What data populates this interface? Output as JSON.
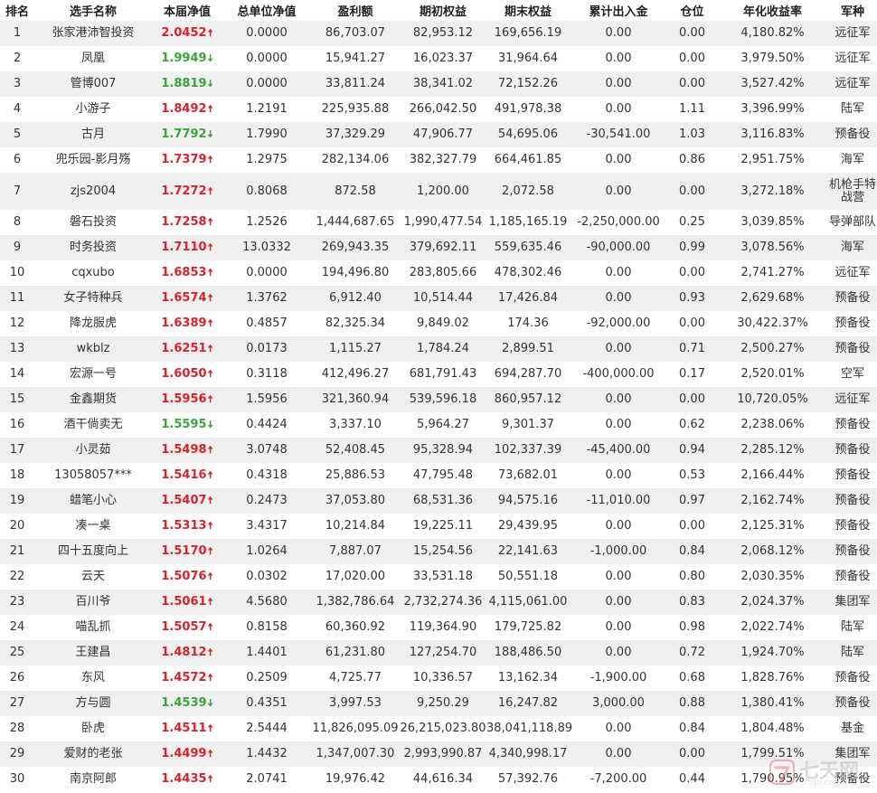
{
  "headers": [
    "排名",
    "选手名称",
    "本届净值",
    "总单位净值",
    "盈利额",
    "期初权益",
    "期末权益",
    "累计出入金",
    "仓位",
    "年化收益率",
    "军种"
  ],
  "rows": [
    {
      "rank": "1",
      "name": "张家港沛智投资",
      "nav": "2.0452",
      "dir": "up",
      "total_nav": "0.0000",
      "profit": "86,703.07",
      "begin": "82,953.12",
      "end": "169,656.19",
      "flow": "0.00",
      "position": "0.00",
      "annual": "4,180.82%",
      "military": "远征军"
    },
    {
      "rank": "2",
      "name": "凤凰",
      "nav": "1.9949",
      "dir": "down",
      "total_nav": "0.0000",
      "profit": "15,941.27",
      "begin": "16,023.37",
      "end": "31,964.64",
      "flow": "0.00",
      "position": "0.00",
      "annual": "3,979.50%",
      "military": "远征军"
    },
    {
      "rank": "3",
      "name": "管博007",
      "nav": "1.8819",
      "dir": "down",
      "total_nav": "0.0000",
      "profit": "33,811.24",
      "begin": "38,341.02",
      "end": "72,152.26",
      "flow": "0.00",
      "position": "0.00",
      "annual": "3,527.42%",
      "military": "远征军"
    },
    {
      "rank": "4",
      "name": "小游子",
      "nav": "1.8492",
      "dir": "up",
      "total_nav": "1.2191",
      "profit": "225,935.88",
      "begin": "266,042.50",
      "end": "491,978.38",
      "flow": "0.00",
      "position": "1.11",
      "annual": "3,396.99%",
      "military": "陆军"
    },
    {
      "rank": "5",
      "name": "古月",
      "nav": "1.7792",
      "dir": "down",
      "total_nav": "1.7990",
      "profit": "37,329.29",
      "begin": "47,906.77",
      "end": "54,695.06",
      "flow": "-30,541.00",
      "position": "1.03",
      "annual": "3,116.83%",
      "military": "预备役"
    },
    {
      "rank": "6",
      "name": "兜乐园-影月殇",
      "nav": "1.7379",
      "dir": "up",
      "total_nav": "1.2975",
      "profit": "282,134.06",
      "begin": "382,327.79",
      "end": "664,461.85",
      "flow": "0.00",
      "position": "0.86",
      "annual": "2,951.75%",
      "military": "海军"
    },
    {
      "rank": "7",
      "name": "zjs2004",
      "nav": "1.7272",
      "dir": "up",
      "total_nav": "0.8068",
      "profit": "872.58",
      "begin": "1,200.00",
      "end": "2,072.58",
      "flow": "0.00",
      "position": "0.00",
      "annual": "3,272.18%",
      "military": "机枪手特战营"
    },
    {
      "rank": "8",
      "name": "磐石投资",
      "nav": "1.7258",
      "dir": "up",
      "total_nav": "1.2526",
      "profit": "1,444,687.65",
      "begin": "1,990,477.54",
      "end": "1,185,165.19",
      "flow": "-2,250,000.00",
      "position": "0.25",
      "annual": "3,039.85%",
      "military": "导弹部队"
    },
    {
      "rank": "9",
      "name": "时务投资",
      "nav": "1.7110",
      "dir": "up",
      "total_nav": "13.0332",
      "profit": "269,943.35",
      "begin": "379,692.11",
      "end": "559,635.46",
      "flow": "-90,000.00",
      "position": "0.99",
      "annual": "3,078.56%",
      "military": "海军"
    },
    {
      "rank": "10",
      "name": "cqxubo",
      "nav": "1.6853",
      "dir": "up",
      "total_nav": "0.0000",
      "profit": "194,496.80",
      "begin": "283,805.66",
      "end": "478,302.46",
      "flow": "0.00",
      "position": "0.00",
      "annual": "2,741.27%",
      "military": "远征军"
    },
    {
      "rank": "11",
      "name": "女子特种兵",
      "nav": "1.6574",
      "dir": "up",
      "total_nav": "1.3762",
      "profit": "6,912.40",
      "begin": "10,514.44",
      "end": "17,426.84",
      "flow": "0.00",
      "position": "0.93",
      "annual": "2,629.68%",
      "military": "预备役"
    },
    {
      "rank": "12",
      "name": "降龙服虎",
      "nav": "1.6389",
      "dir": "up",
      "total_nav": "0.4857",
      "profit": "82,325.34",
      "begin": "9,849.02",
      "end": "174.36",
      "flow": "-92,000.00",
      "position": "0.00",
      "annual": "30,422.37%",
      "military": "预备役"
    },
    {
      "rank": "13",
      "name": "wkblz",
      "nav": "1.6251",
      "dir": "up",
      "total_nav": "0.0173",
      "profit": "1,115.27",
      "begin": "1,784.24",
      "end": "2,899.51",
      "flow": "0.00",
      "position": "0.71",
      "annual": "2,500.27%",
      "military": "预备役"
    },
    {
      "rank": "14",
      "name": "宏源一号",
      "nav": "1.6050",
      "dir": "up",
      "total_nav": "0.3118",
      "profit": "412,496.27",
      "begin": "681,791.43",
      "end": "694,287.70",
      "flow": "-400,000.00",
      "position": "0.17",
      "annual": "2,520.01%",
      "military": "空军"
    },
    {
      "rank": "15",
      "name": "金鑫期货",
      "nav": "1.5956",
      "dir": "up",
      "total_nav": "1.5956",
      "profit": "321,360.94",
      "begin": "539,596.18",
      "end": "860,957.12",
      "flow": "0.00",
      "position": "0.00",
      "annual": "10,720.05%",
      "military": "远征军"
    },
    {
      "rank": "16",
      "name": "酒干倘卖无",
      "nav": "1.5595",
      "dir": "down",
      "total_nav": "0.4424",
      "profit": "3,337.10",
      "begin": "5,964.27",
      "end": "9,301.37",
      "flow": "0.00",
      "position": "0.62",
      "annual": "2,238.06%",
      "military": "预备役"
    },
    {
      "rank": "17",
      "name": "小灵茹",
      "nav": "1.5498",
      "dir": "up",
      "total_nav": "3.0748",
      "profit": "52,408.45",
      "begin": "95,328.94",
      "end": "102,337.39",
      "flow": "-45,400.00",
      "position": "0.94",
      "annual": "2,285.12%",
      "military": "预备役"
    },
    {
      "rank": "18",
      "name": "13058057***",
      "nav": "1.5416",
      "dir": "up",
      "total_nav": "0.4318",
      "profit": "25,886.53",
      "begin": "47,795.48",
      "end": "73,682.01",
      "flow": "0.00",
      "position": "0.53",
      "annual": "2,166.44%",
      "military": "预备役"
    },
    {
      "rank": "19",
      "name": "蜡笔小心",
      "nav": "1.5407",
      "dir": "up",
      "total_nav": "0.2473",
      "profit": "37,053.80",
      "begin": "68,531.36",
      "end": "94,575.16",
      "flow": "-11,010.00",
      "position": "0.97",
      "annual": "2,162.74%",
      "military": "预备役"
    },
    {
      "rank": "20",
      "name": "凑一桌",
      "nav": "1.5313",
      "dir": "up",
      "total_nav": "3.4317",
      "profit": "10,214.84",
      "begin": "19,225.11",
      "end": "29,439.95",
      "flow": "0.00",
      "position": "0.00",
      "annual": "2,125.31%",
      "military": "预备役"
    },
    {
      "rank": "21",
      "name": "四十五度向上",
      "nav": "1.5170",
      "dir": "up",
      "total_nav": "1.0264",
      "profit": "7,887.07",
      "begin": "15,254.56",
      "end": "22,141.63",
      "flow": "-1,000.00",
      "position": "0.84",
      "annual": "2,068.12%",
      "military": "预备役"
    },
    {
      "rank": "22",
      "name": "云天",
      "nav": "1.5076",
      "dir": "up",
      "total_nav": "0.0302",
      "profit": "17,020.00",
      "begin": "33,531.18",
      "end": "50,551.18",
      "flow": "0.00",
      "position": "0.80",
      "annual": "2,030.35%",
      "military": "预备役"
    },
    {
      "rank": "23",
      "name": "百川爷",
      "nav": "1.5061",
      "dir": "up",
      "total_nav": "4.5680",
      "profit": "1,382,786.64",
      "begin": "2,732,274.36",
      "end": "4,115,061.00",
      "flow": "0.00",
      "position": "0.83",
      "annual": "2,024.37%",
      "military": "集团军"
    },
    {
      "rank": "24",
      "name": "喵乱抓",
      "nav": "1.5057",
      "dir": "up",
      "total_nav": "0.8158",
      "profit": "60,360.92",
      "begin": "119,364.90",
      "end": "179,725.82",
      "flow": "0.00",
      "position": "0.98",
      "annual": "2,022.74%",
      "military": "陆军"
    },
    {
      "rank": "25",
      "name": "王建昌",
      "nav": "1.4812",
      "dir": "up",
      "total_nav": "1.4401",
      "profit": "61,231.80",
      "begin": "127,254.70",
      "end": "188,486.50",
      "flow": "0.00",
      "position": "0.72",
      "annual": "1,924.70%",
      "military": "陆军"
    },
    {
      "rank": "26",
      "name": "东风",
      "nav": "1.4572",
      "dir": "up",
      "total_nav": "0.2509",
      "profit": "4,725.77",
      "begin": "10,336.57",
      "end": "13,162.34",
      "flow": "-1,900.00",
      "position": "0.68",
      "annual": "1,828.76%",
      "military": "预备役"
    },
    {
      "rank": "27",
      "name": "方与圆",
      "nav": "1.4539",
      "dir": "down",
      "total_nav": "0.4351",
      "profit": "3,997.53",
      "begin": "9,250.29",
      "end": "16,247.82",
      "flow": "3,000.00",
      "position": "0.88",
      "annual": "1,380.41%",
      "military": "预备役"
    },
    {
      "rank": "28",
      "name": "卧虎",
      "nav": "1.4511",
      "dir": "up",
      "total_nav": "2.5444",
      "profit": "11,826,095.09",
      "begin": "26,215,023.80",
      "end": "38,041,118.89",
      "flow": "0.00",
      "position": "0.84",
      "annual": "1,804.48%",
      "military": "基金"
    },
    {
      "rank": "29",
      "name": "爱财的老张",
      "nav": "1.4499",
      "dir": "up",
      "total_nav": "1.4432",
      "profit": "1,347,007.30",
      "begin": "2,993,990.87",
      "end": "4,340,998.17",
      "flow": "0.00",
      "position": "0.00",
      "annual": "1,799.51%",
      "military": "集团军"
    },
    {
      "rank": "30",
      "name": "南京阿郎",
      "nav": "1.4435",
      "dir": "up",
      "total_nav": "2.0741",
      "profit": "19,976.42",
      "begin": "44,616.34",
      "end": "57,392.76",
      "flow": "-7,200.00",
      "position": "0.44",
      "annual": "1,790.95%",
      "military": "预备役"
    }
  ],
  "arrows": {
    "up": "🠅",
    "down": "🠇"
  },
  "colors": {
    "up": "#d9232b",
    "down": "#3aa33a",
    "row_alt": "#f0f0f0"
  },
  "watermark": {
    "text": "七天网",
    "url": "7tqh.com"
  }
}
